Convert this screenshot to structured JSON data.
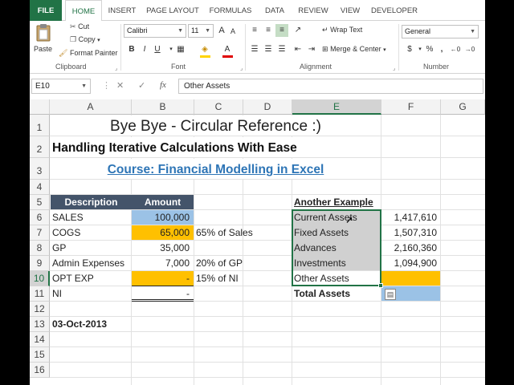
{
  "ribbon_tabs": [
    "FILE",
    "HOME",
    "INSERT",
    "PAGE LAYOUT",
    "FORMULAS",
    "DATA",
    "REVIEW",
    "VIEW",
    "DEVELOPER"
  ],
  "clipboard": {
    "paste": "Paste",
    "cut": "Cut",
    "copy": "Copy",
    "format_painter": "Format Painter",
    "label": "Clipboard"
  },
  "font": {
    "name": "Calibri",
    "size": "11",
    "label": "Font",
    "bold": "B",
    "italic": "I",
    "underline": "U"
  },
  "alignment": {
    "wrap_text": "Wrap Text",
    "merge_center": "Merge & Center",
    "label": "Alignment"
  },
  "number": {
    "format": "General",
    "currency": "$",
    "percent": "%",
    "comma": ",",
    "label": "Number"
  },
  "formula_bar": {
    "name_box": "E10",
    "fx": "fx",
    "formula": "Other Assets"
  },
  "columns": [
    "A",
    "B",
    "C",
    "D",
    "E",
    "F",
    "G"
  ],
  "rows": [
    "1",
    "2",
    "3",
    "4",
    "5",
    "6",
    "7",
    "8",
    "9",
    "10",
    "11",
    "12",
    "13",
    "14",
    "15",
    "16"
  ],
  "colors": {
    "excel_green": "#217346",
    "header_dark": "#44546a",
    "blue_fill": "#9bc2e6",
    "orange_fill": "#ffc000",
    "gray_fill": "#d0d0d0",
    "link_blue": "#2e75b6"
  },
  "sheet": {
    "title": "Bye Bye - Circular Reference :)",
    "subtitle": "Handling Iterative Calculations With Ease",
    "course": "Course: Financial Modelling in Excel",
    "table1": {
      "headers": [
        "Description",
        "Amount"
      ],
      "rows": [
        {
          "desc": "SALES",
          "amount": "100,000",
          "note": ""
        },
        {
          "desc": "COGS",
          "amount": "65,000",
          "note": "65% of Sales"
        },
        {
          "desc": "GP",
          "amount": "35,000",
          "note": ""
        },
        {
          "desc": "Admin Expenses",
          "amount": "7,000",
          "note": "20% of GP"
        },
        {
          "desc": "OPT EXP",
          "amount": "-",
          "note": "15% of NI"
        },
        {
          "desc": "NI",
          "amount": "-",
          "note": ""
        }
      ]
    },
    "date": "03-Oct-2013",
    "table2": {
      "header": "Another Example",
      "rows": [
        {
          "label": "Current Assets",
          "value": "1,417,610"
        },
        {
          "label": "Fixed Assets",
          "value": "1,507,310"
        },
        {
          "label": "Advances",
          "value": "2,160,360"
        },
        {
          "label": "Investments",
          "value": "1,094,900"
        },
        {
          "label": "Other Assets",
          "value": ""
        }
      ],
      "total_label": "Total Assets"
    }
  }
}
